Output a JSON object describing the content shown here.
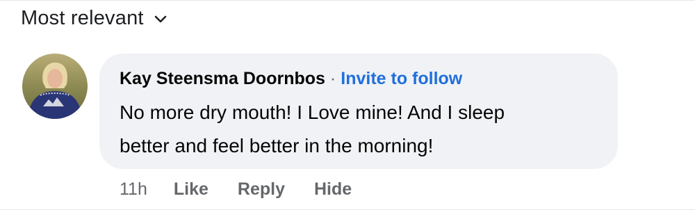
{
  "sort": {
    "label": "Most relevant",
    "icon": "chevron-down-icon"
  },
  "comment": {
    "author": "Kay Steensma Doornbos",
    "separator": "·",
    "invite_label": "Invite to follow",
    "body_lines": [
      "No more dry mouth! I Love mine! And I sleep",
      "better and feel better in the morning!"
    ],
    "timestamp": "11h",
    "actions": {
      "like": "Like",
      "reply": "Reply",
      "hide": "Hide"
    },
    "avatar_icon": "user-avatar",
    "colors": {
      "bubble": "#f0f2f5",
      "link": "#216fdb",
      "muted": "#65676b",
      "text": "#050505"
    }
  }
}
